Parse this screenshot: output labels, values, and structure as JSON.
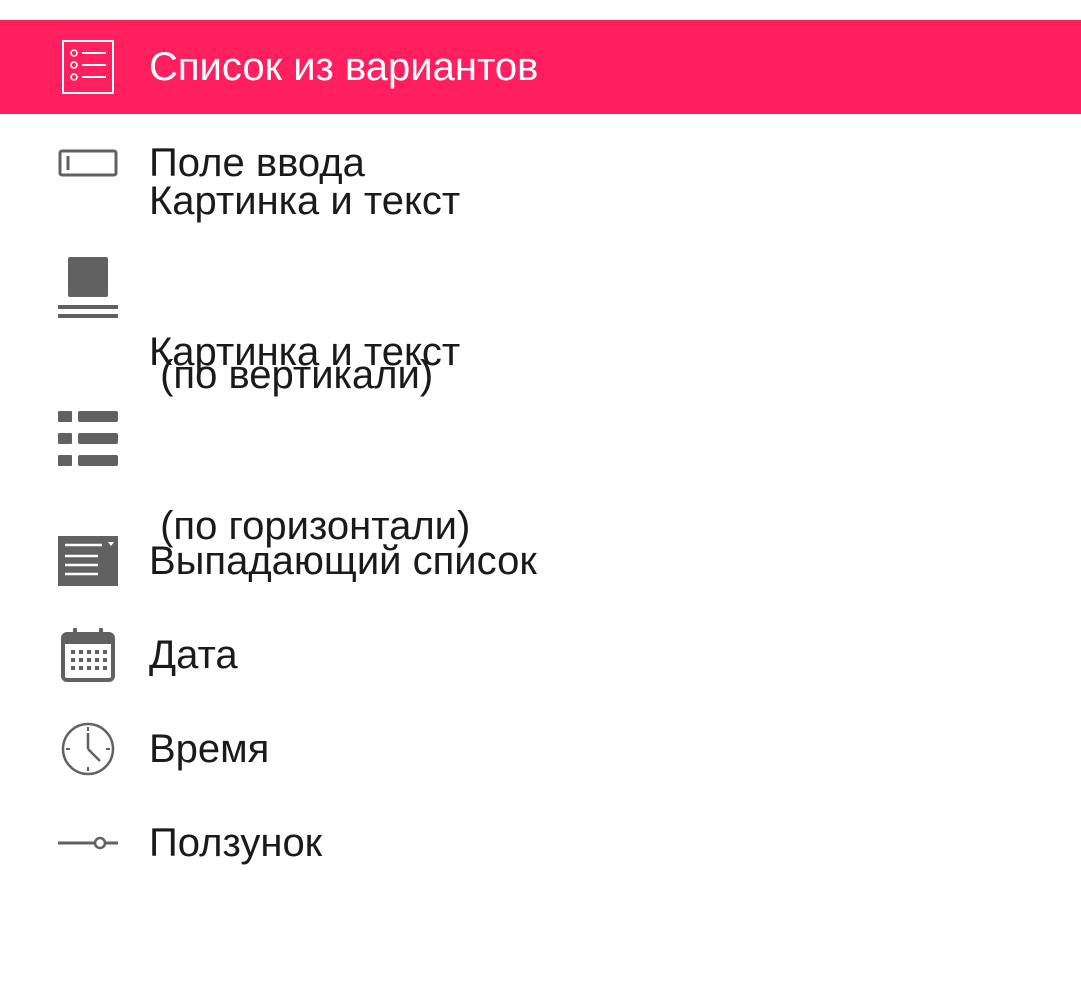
{
  "menu": {
    "accent_color": "#ff1f5e",
    "icon_color": "#616161",
    "items": [
      {
        "id": "choice-list",
        "icon": "checklist-icon",
        "lines": [
          "Список из вариантов"
        ],
        "selected": true
      },
      {
        "id": "input-field",
        "icon": "input-field-icon",
        "lines": [
          "Поле ввода"
        ],
        "selected": false
      },
      {
        "id": "image-text-vertical",
        "icon": "image-text-vertical-icon",
        "lines": [
          "Картинка и текст",
          " (по вертикали)"
        ],
        "selected": false
      },
      {
        "id": "image-text-horizontal",
        "icon": "image-text-horizontal-icon",
        "lines": [
          "Картинка и текст",
          " (по горизонтали)"
        ],
        "selected": false
      },
      {
        "id": "dropdown",
        "icon": "dropdown-list-icon",
        "lines": [
          "Выпадающий список"
        ],
        "selected": false
      },
      {
        "id": "date",
        "icon": "calendar-icon",
        "lines": [
          "Дата"
        ],
        "selected": false
      },
      {
        "id": "time",
        "icon": "clock-icon",
        "lines": [
          "Время"
        ],
        "selected": false
      },
      {
        "id": "slider",
        "icon": "slider-icon",
        "lines": [
          "Ползунок"
        ],
        "selected": false
      }
    ]
  }
}
